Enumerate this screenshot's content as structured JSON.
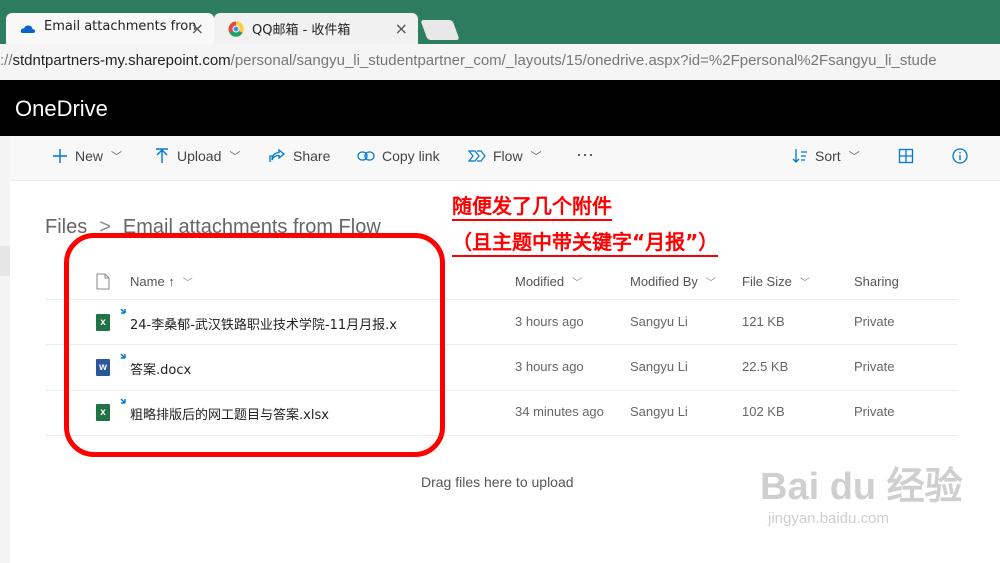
{
  "browser": {
    "tabs": [
      {
        "title": "Email attachments fron",
        "icon": "onedrive-cloud-icon",
        "close": "×"
      },
      {
        "title": "QQ邮箱 - 收件箱",
        "icon": "qq-mail-icon",
        "close": "×"
      }
    ],
    "url_prefix": "://",
    "url_host": "stdntpartners-my.sharepoint.com",
    "url_path": "/personal/sangyu_li_studentpartner_com/_layouts/15/onedrive.aspx?id=%2Fpersonal%2Fsangyu_li_stude"
  },
  "app": {
    "name": "OneDrive"
  },
  "toolbar": {
    "new_label": "New",
    "upload_label": "Upload",
    "share_label": "Share",
    "copy_link_label": "Copy link",
    "flow_label": "Flow",
    "more_label": "···",
    "sort_label": "Sort"
  },
  "breadcrumb": {
    "root": "Files",
    "separator": ">",
    "current": "Email attachments from Flow"
  },
  "table": {
    "headers": {
      "name": "Name ↑",
      "modified": "Modified",
      "modified_by": "Modified By",
      "file_size": "File Size",
      "sharing": "Sharing"
    },
    "rows": [
      {
        "type": "xlsx",
        "name": "24-李桑郁-武汉铁路职业技术学院-11月月报.x",
        "modified": "3 hours ago",
        "modified_by": "Sangyu Li",
        "size": "121 KB",
        "sharing": "Private"
      },
      {
        "type": "docx",
        "name": "答案.docx",
        "modified": "3 hours ago",
        "modified_by": "Sangyu Li",
        "size": "22.5 KB",
        "sharing": "Private"
      },
      {
        "type": "xlsx",
        "name": "粗略排版后的网工题目与答案.xlsx",
        "modified": "34 minutes ago",
        "modified_by": "Sangyu Li",
        "size": "102 KB",
        "sharing": "Private"
      }
    ],
    "drop_text": "Drag files here to upload"
  },
  "annotation": {
    "line1": "随便发了几个附件",
    "line2": "（且主题中带关键字“月报”）",
    "color": "#ff0000"
  },
  "watermark": {
    "brand": "Bai du 经验",
    "url": "jingyan.baidu.com"
  },
  "colors": {
    "tab_bar": "#2d7d5e",
    "app_bar": "#000000",
    "accent": "#0078d4",
    "excel": "#217346",
    "word": "#2b579a"
  }
}
